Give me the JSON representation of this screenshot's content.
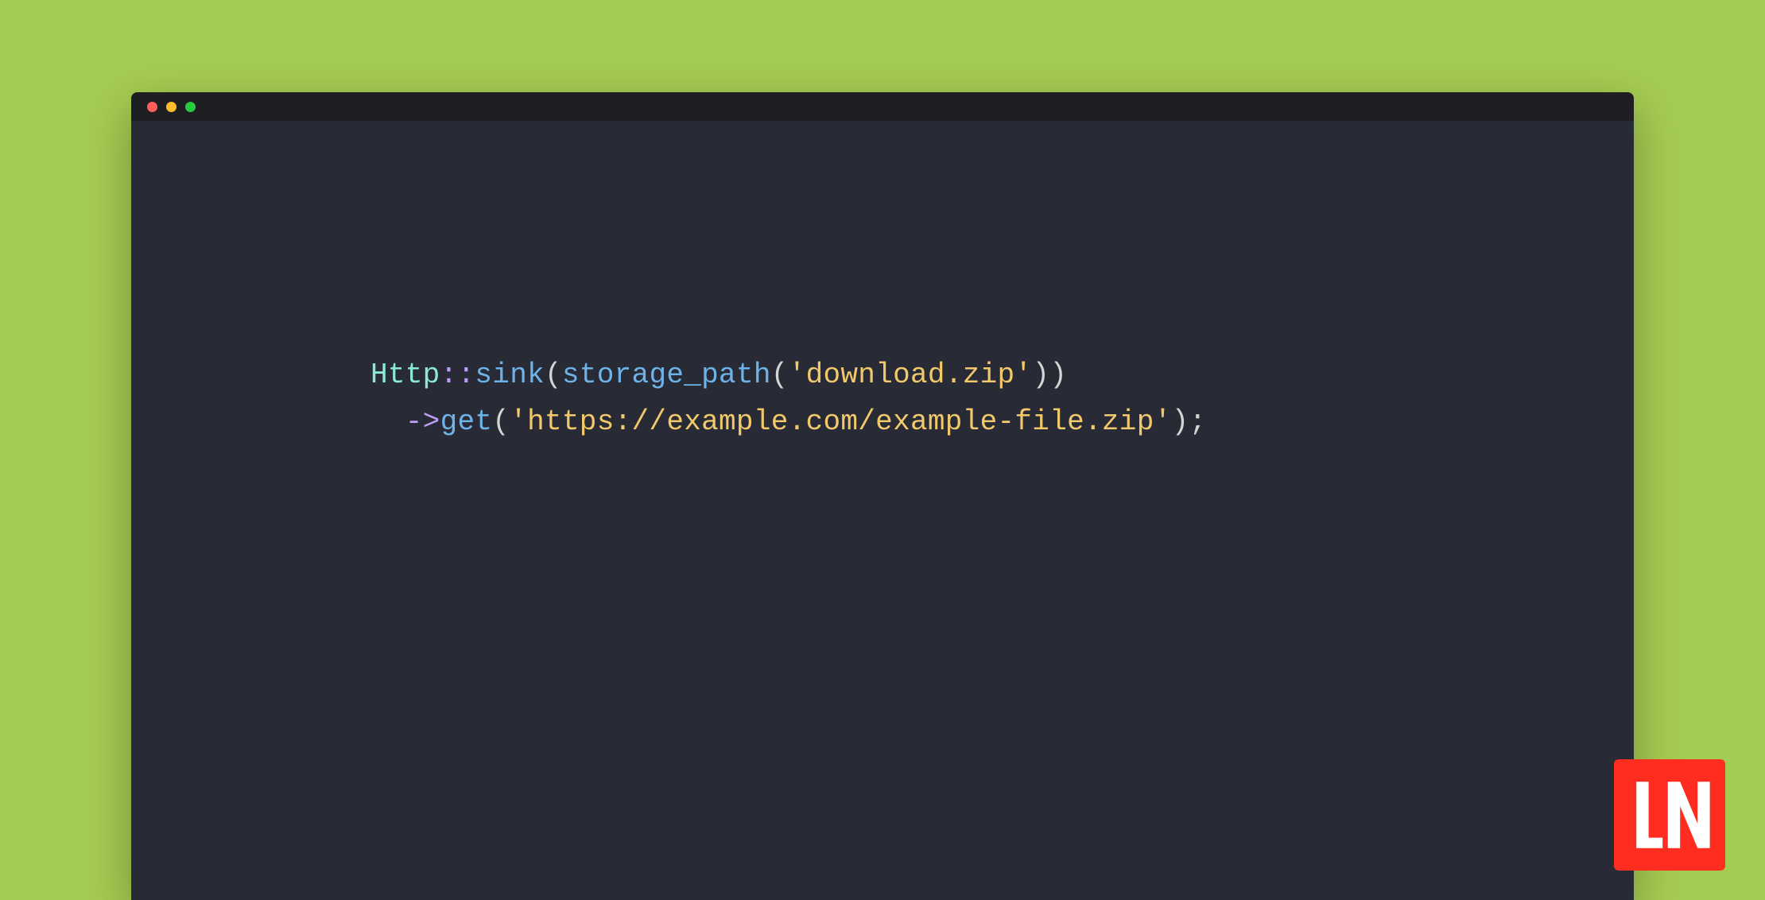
{
  "code": {
    "line1": {
      "indent": "           ",
      "class": "Http",
      "scope": "::",
      "func1": "sink",
      "paren1": "(",
      "func2": "storage_path",
      "paren2": "(",
      "string1": "'download.zip'",
      "paren3": "))"
    },
    "line2": {
      "indent": "             ",
      "arrow": "->",
      "func": "get",
      "paren1": "(",
      "string": "'https://example.com/example-file.zip'",
      "paren2": ")",
      "semi": ";"
    }
  },
  "logo": {
    "text": "LN"
  },
  "colors": {
    "background": "#a5cc52",
    "window": "#282a36",
    "titlebar": "#1e1f23",
    "trafficRed": "#ff5f56",
    "trafficYellow": "#ffbd2e",
    "trafficGreen": "#27c93f",
    "logo": "#ff2d20"
  }
}
